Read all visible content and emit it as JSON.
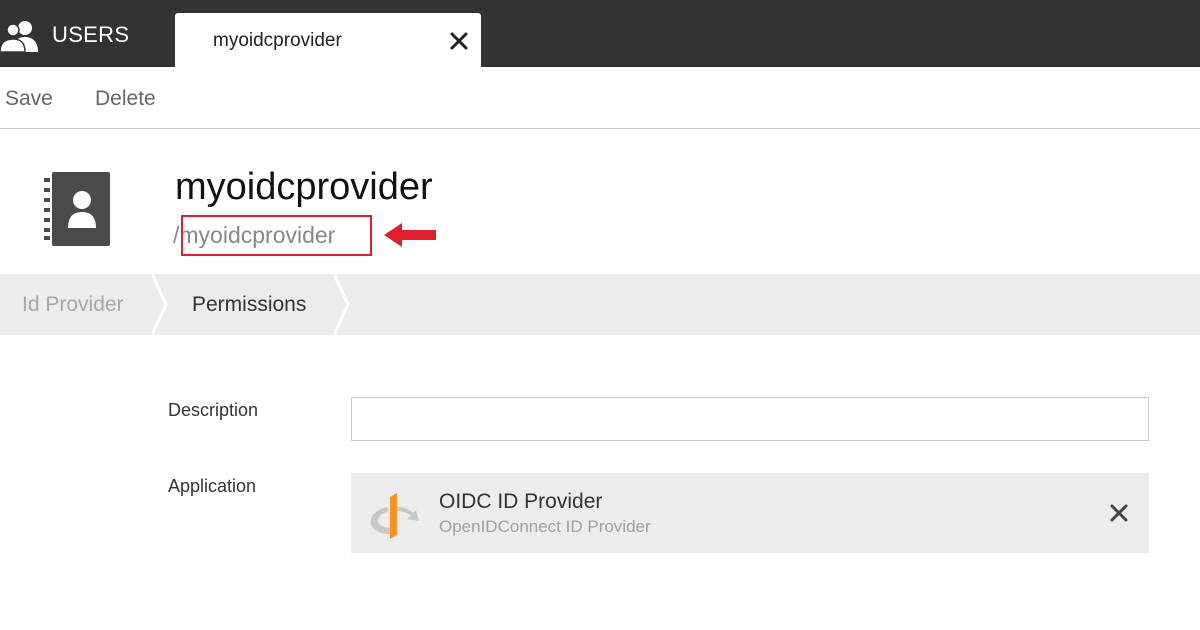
{
  "topbar": {
    "app_label": "USERS",
    "app_icon": "users-icon",
    "tab_label": "myoidcprovider",
    "tab_close_icon": "close-icon"
  },
  "toolbar": {
    "save_label": "Save",
    "delete_label": "Delete"
  },
  "header": {
    "icon": "address-book-icon",
    "title": "myoidcprovider",
    "path": "/myoidcprovider",
    "annotation_color": "#e0202a"
  },
  "steps": [
    {
      "label": "Id Provider",
      "state": "inactive"
    },
    {
      "label": "Permissions",
      "state": "active"
    }
  ],
  "form": {
    "description_label": "Description",
    "description_value": "",
    "application_label": "Application",
    "application": {
      "icon": "openid-icon",
      "name": "OIDC ID Provider",
      "description": "OpenIDConnect ID Provider",
      "remove_icon": "close-icon"
    }
  },
  "colors": {
    "topbar": "#333333",
    "accent_orange": "#f7931e",
    "step_bg": "#ececec"
  }
}
